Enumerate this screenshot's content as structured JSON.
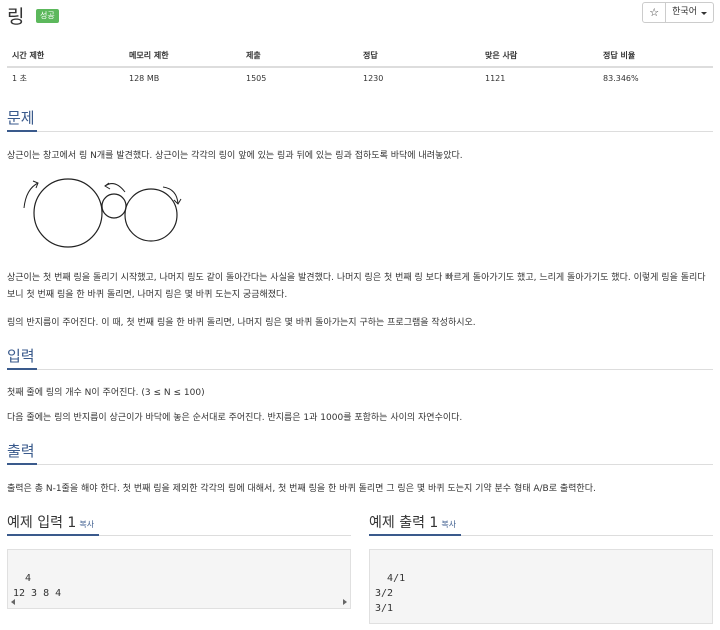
{
  "problem": {
    "title": "링",
    "status_badge": "성공"
  },
  "toolbar": {
    "star": "☆",
    "language": "한국어"
  },
  "stats": {
    "headers": [
      "시간 제한",
      "메모리 제한",
      "제출",
      "정답",
      "맞은 사람",
      "정답 비율"
    ],
    "values": [
      "1 초",
      "128 MB",
      "1505",
      "1230",
      "1121",
      "83.346%"
    ]
  },
  "sections": {
    "problem": {
      "title": "문제",
      "p1": "상근이는 창고에서 링 N개를 발견했다. 상근이는 각각의 링이 앞에 있는 링과 뒤에 있는 링과 접하도록 바닥에 내려놓았다.",
      "p2": "상근이는 첫 번째 링을 돌리기 시작했고, 나머지 링도 같이 돌아간다는 사실을 발견했다. 나머지 링은 첫 번째 링 보다 빠르게 돌아가기도 했고, 느리게 돌아가기도 했다. 이렇게 링을 돌리다 보니 첫 번째 링을 한 바퀴 돌리면, 나머지 링은 몇 바퀴 도는지 궁금해졌다.",
      "p3": "링의 반지름이 주어진다. 이 때, 첫 번째 링을 한 바퀴 돌리면, 나머지 링은 몇 바퀴 돌아가는지 구하는 프로그램을 작성하시오."
    },
    "input": {
      "title": "입력",
      "p1": "첫째 줄에 링의 개수 N이 주어진다. (3 ≤ N ≤ 100)",
      "p2": "다음 줄에는 링의 반지름이 상근이가 바닥에 놓은 순서대로 주어진다. 반지름은 1과 1000를 포함하는 사이의 자연수이다."
    },
    "output": {
      "title": "출력",
      "p1": "출력은 총 N-1줄을 해야 한다. 첫 번째 링을 제외한 각각의 링에 대해서, 첫 번째 링을 한 바퀴 돌리면 그 링은 몇 바퀴 도는지 기약 분수 형태 A/B로 출력한다."
    }
  },
  "examples": {
    "input": {
      "title": "예제 입력 1",
      "copy": "복사",
      "content": "4\n12 3 8 4"
    },
    "output": {
      "title": "예제 출력 1",
      "copy": "복사",
      "content": "4/1\n3/2\n3/1"
    }
  }
}
